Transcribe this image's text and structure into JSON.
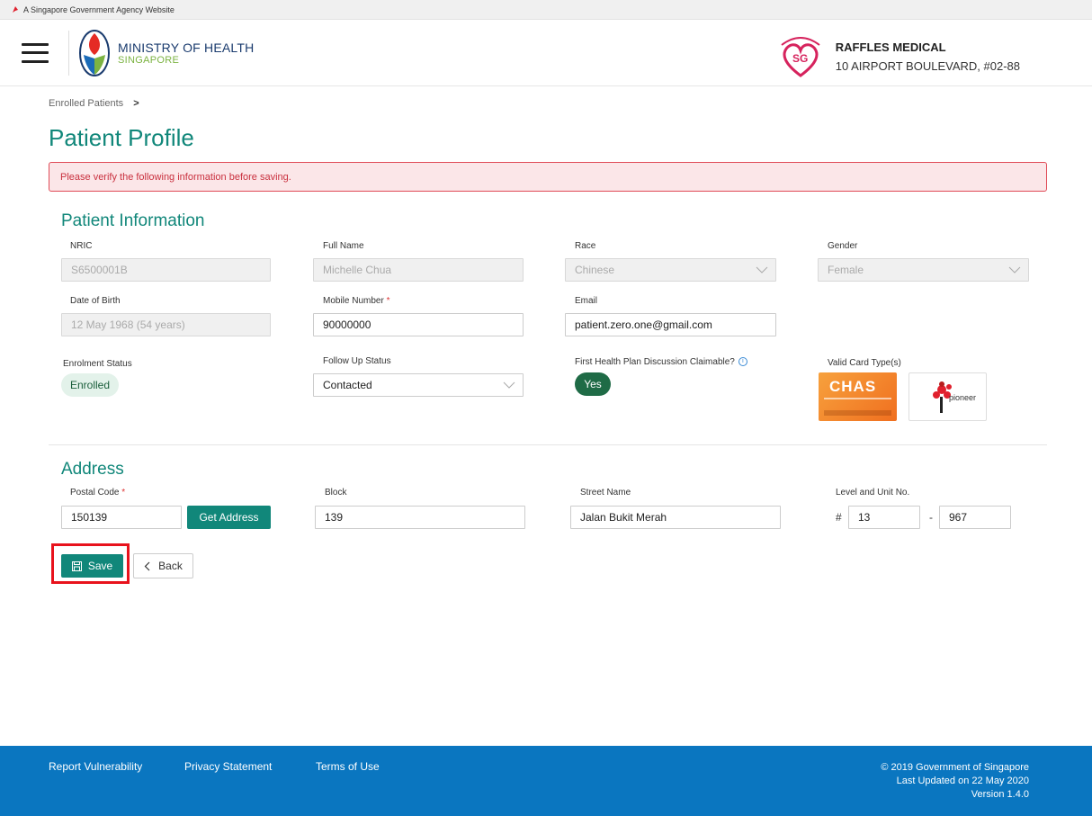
{
  "masthead": {
    "text": "A Singapore Government Agency Website"
  },
  "header": {
    "ministry_line1": "MINISTRY OF HEALTH",
    "ministry_line2": "SINGAPORE",
    "clinic_name": "RAFFLES MEDICAL",
    "clinic_address": "10 AIRPORT BOULEVARD, #02-88"
  },
  "breadcrumb": {
    "item": "Enrolled Patients",
    "separator": ">"
  },
  "page": {
    "title": "Patient Profile"
  },
  "alert": {
    "message": "Please verify the following information before saving."
  },
  "patient_info": {
    "title": "Patient Information",
    "nric": {
      "label": "NRIC",
      "value": "S6500001B"
    },
    "full_name": {
      "label": "Full Name",
      "value": "Michelle Chua"
    },
    "race": {
      "label": "Race",
      "value": "Chinese"
    },
    "gender": {
      "label": "Gender",
      "value": "Female"
    },
    "dob": {
      "label": "Date of Birth",
      "value": "12 May 1968 (54 years)"
    },
    "mobile": {
      "label": "Mobile Number",
      "required_mark": "*",
      "value": "90000000"
    },
    "email": {
      "label": "Email",
      "value": "patient.zero.one@gmail.com"
    },
    "enrolment_status": {
      "label": "Enrolment Status",
      "value": "Enrolled"
    },
    "follow_up": {
      "label": "Follow Up Status",
      "value": "Contacted"
    },
    "first_hpd": {
      "label": "First Health Plan Discussion Claimable?",
      "value": "Yes"
    },
    "valid_cards": {
      "label": "Valid Card Type(s)",
      "chas_text": "CHAS",
      "pioneer_text": "pioneer"
    }
  },
  "address": {
    "title": "Address",
    "postal_code": {
      "label": "Postal Code",
      "required_mark": "*",
      "value": "150139"
    },
    "get_address_label": "Get Address",
    "block": {
      "label": "Block",
      "value": "139"
    },
    "street": {
      "label": "Street Name",
      "value": "Jalan Bukit Merah"
    },
    "unit": {
      "label": "Level and Unit No.",
      "hash": "#",
      "level": "13",
      "dash": "-",
      "unit": "967"
    }
  },
  "actions": {
    "save_label": "Save",
    "back_label": "Back"
  },
  "footer": {
    "links": [
      "Report Vulnerability",
      "Privacy Statement",
      "Terms of Use"
    ],
    "copyright": "© 2019 Government of Singapore",
    "updated": "Last Updated on 22 May 2020",
    "version": "Version 1.4.0"
  },
  "colors": {
    "brand_teal": "#11877a",
    "footer_blue": "#0a76c0",
    "alert_red": "#e04b57",
    "highlight_red": "#e8121c"
  }
}
